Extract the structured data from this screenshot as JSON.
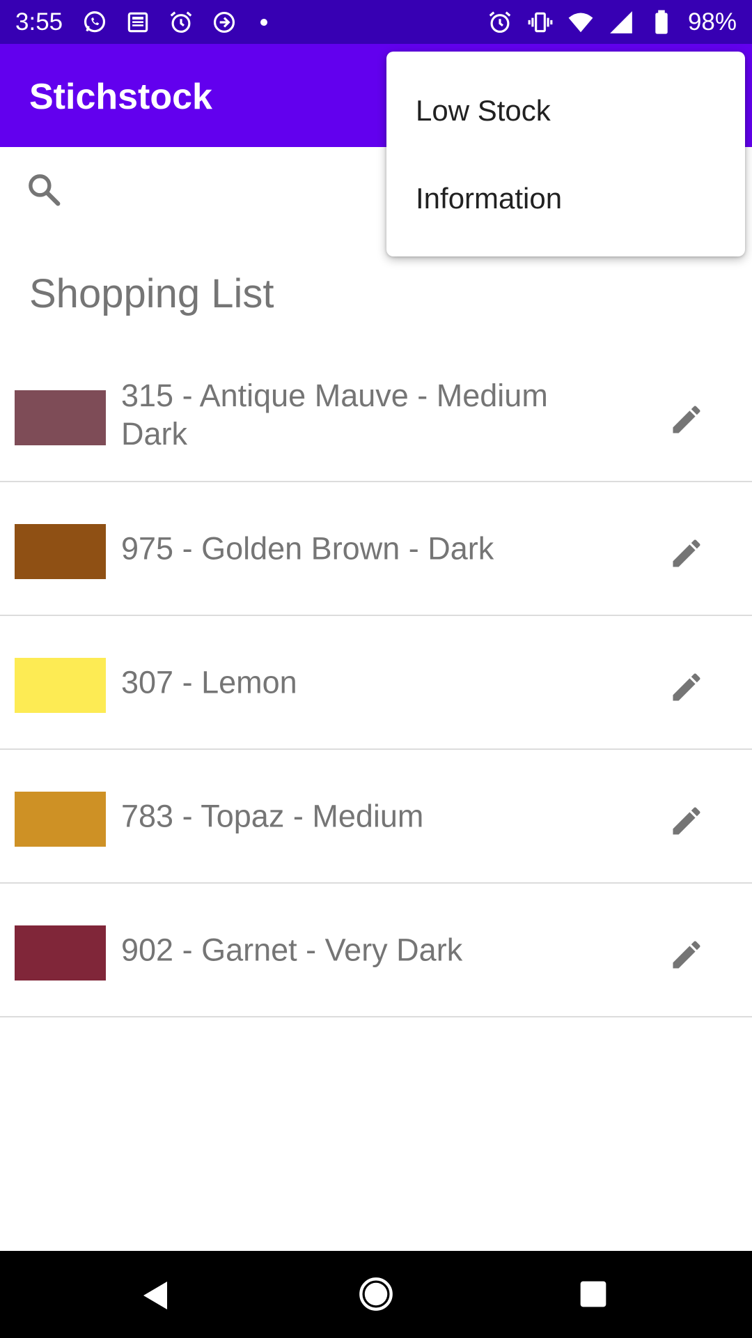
{
  "status_bar": {
    "time": "3:55",
    "battery_pct": "98%",
    "left_icons": [
      "whatsapp-icon",
      "news-icon",
      "alarm-icon",
      "data-saver-icon"
    ],
    "right_icons": [
      "alarm-icon",
      "vibrate-icon",
      "wifi-icon",
      "signal-icon",
      "battery-icon"
    ],
    "bg_color": "#3700b3"
  },
  "app_bar": {
    "title": "Stichstock",
    "bg_color": "#6200ee"
  },
  "search": {
    "icon": "search-icon"
  },
  "section": {
    "title": "Shopping List"
  },
  "items": [
    {
      "label": "315 - Antique Mauve - Medium Dark",
      "color": "#7e4c57"
    },
    {
      "label": "975 - Golden Brown - Dark",
      "color": "#8f5014"
    },
    {
      "label": "307 - Lemon",
      "color": "#fdeb54"
    },
    {
      "label": "783 - Topaz - Medium",
      "color": "#ce9125"
    },
    {
      "label": "902 - Garnet - Very Dark",
      "color": "#802639"
    }
  ],
  "menu": {
    "items": [
      "Low Stock",
      "Information"
    ]
  },
  "nav_bar": {
    "icons": [
      "back-icon",
      "home-icon",
      "recent-apps-icon"
    ]
  }
}
